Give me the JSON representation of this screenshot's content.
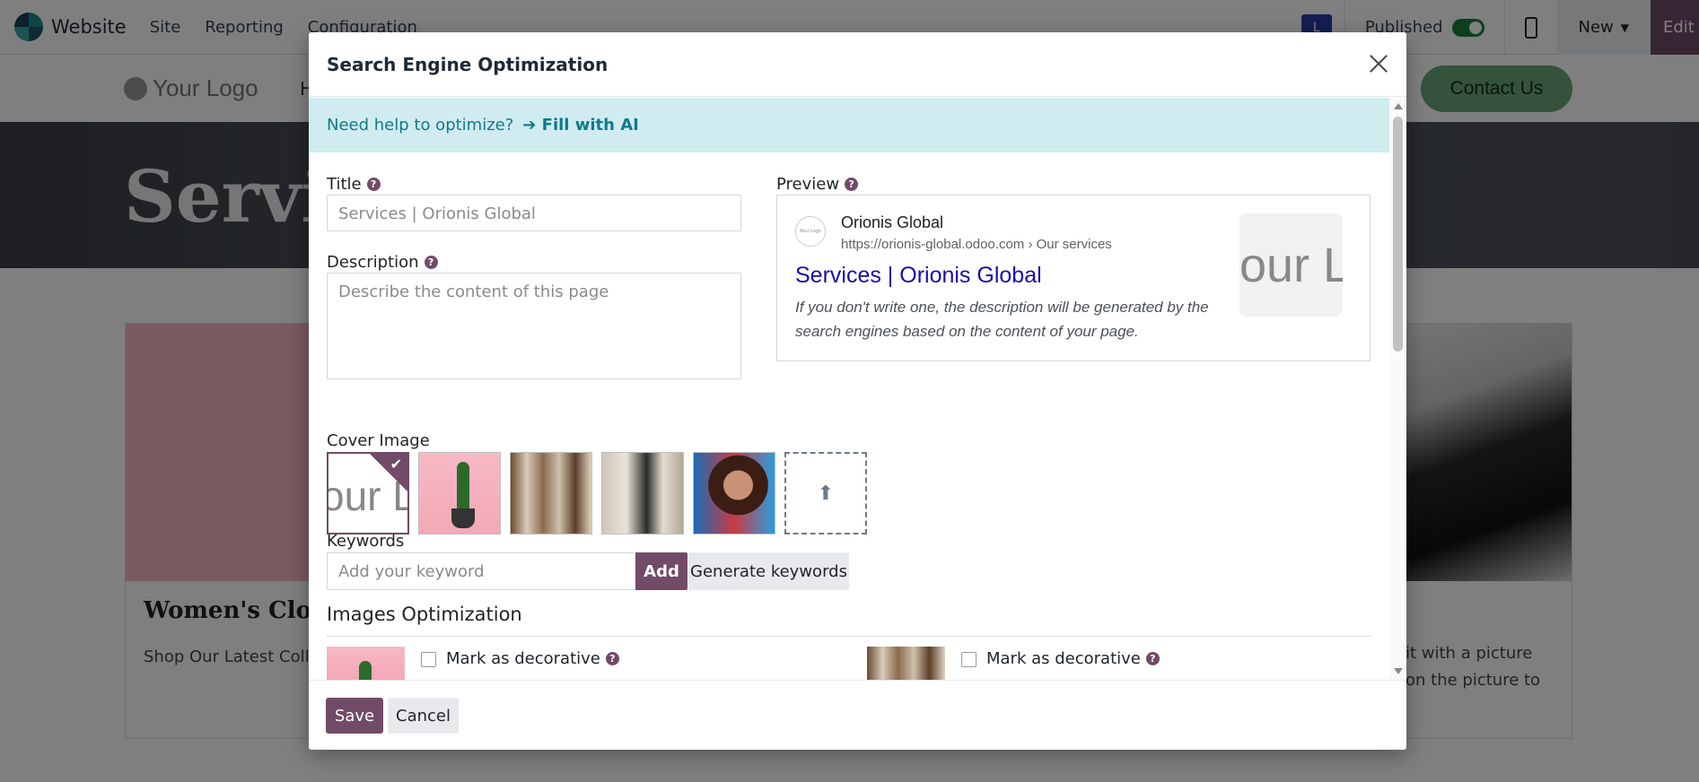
{
  "topbar": {
    "app_name": "Website",
    "menu": [
      "Site",
      "Reporting",
      "Configuration"
    ],
    "user_initial": "L",
    "published_label": "Published",
    "published": true,
    "new_label": "New",
    "edit_label": "Edit"
  },
  "site": {
    "logo_text": "Your Logo",
    "menu_first_letter": "H",
    "contact_label": "Contact Us",
    "hero_title": "Servic",
    "card_left_title": "Women's Cloth",
    "card_left_text": "Shop Our Latest Coll",
    "card_right_text_1": "it with a picture",
    "card_right_text_2": "on the picture to"
  },
  "modal": {
    "title": "Search Engine Optimization",
    "ai_prompt": "Need help to optimize?",
    "ai_link": "Fill with AI",
    "ai_arrow": "➔",
    "title_label": "Title",
    "title_placeholder": "Services | Orionis Global",
    "description_label": "Description",
    "description_placeholder": "Describe the content of this page",
    "preview_label": "Preview",
    "preview": {
      "favicon_text": "Your Logo",
      "site_name": "Orionis Global",
      "url": "https://orionis-global.odoo.com › Our services",
      "title": "Services | Orionis Global",
      "description": "If you don't write one, the description will be generated by the search engines based on the content of your page.",
      "thumb_text": "our L"
    },
    "cover_label": "Cover Image",
    "cover_logo_text": "our L",
    "cover_check": "✔",
    "upload_icon": "⬆",
    "keywords_label": "Keywords",
    "keyword_placeholder": "Add your keyword",
    "add_label": "Add",
    "generate_label": "Generate keywords",
    "images_section": "Images Optimization",
    "decorative_label": "Mark as decorative",
    "help_glyph": "?",
    "save_label": "Save",
    "cancel_label": "Cancel"
  },
  "colors": {
    "primary": "#714b67",
    "info_bg": "#d0ecf0",
    "info_text": "#117a8b",
    "serp_title": "#1a0dab",
    "published_toggle": "#1a7f3c"
  }
}
